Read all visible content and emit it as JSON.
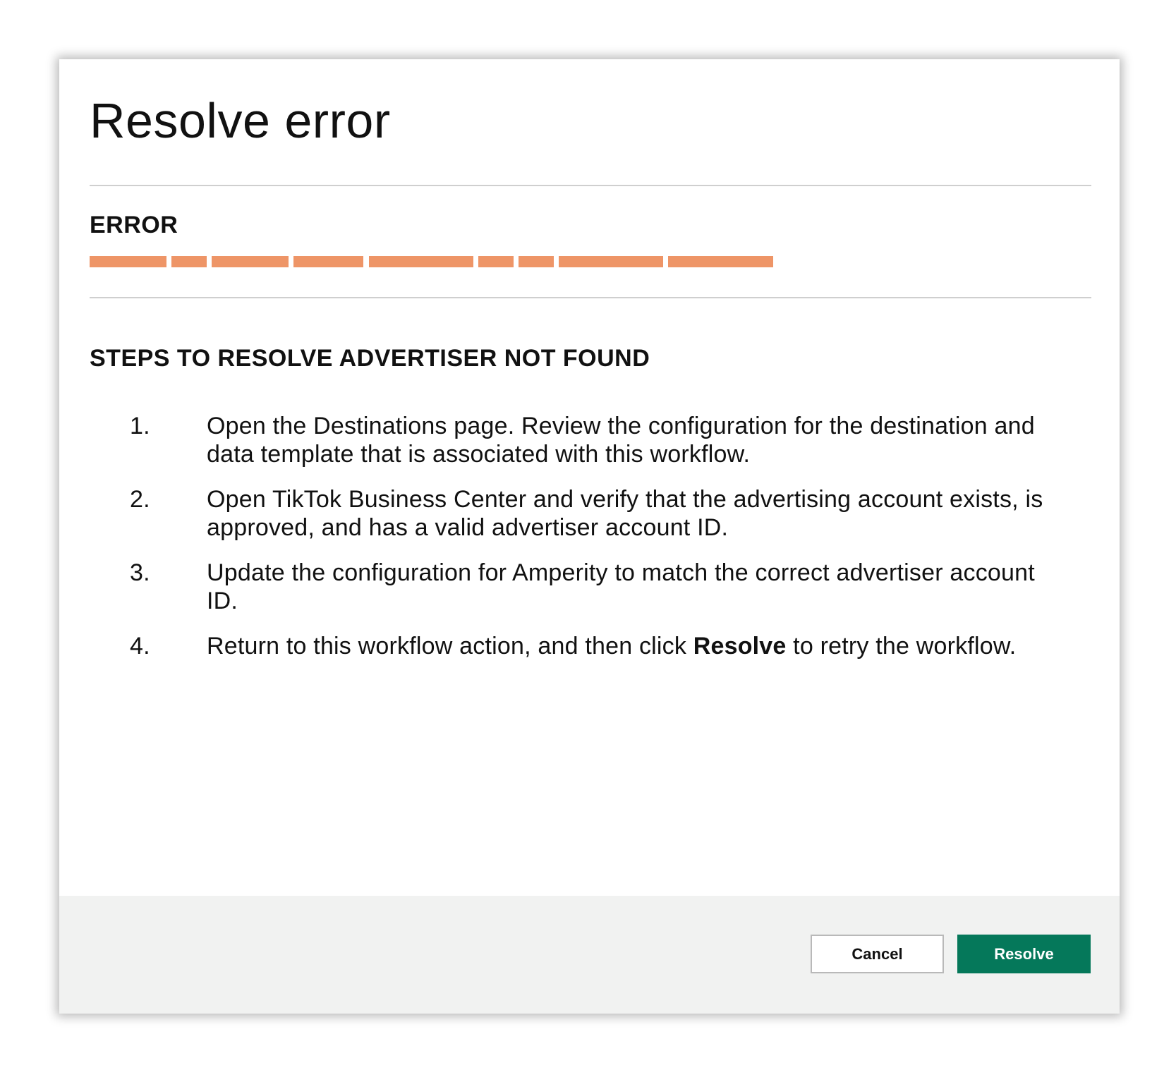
{
  "dialog": {
    "title": "Resolve error",
    "error_label": "ERROR",
    "steps_heading": "STEPS TO RESOLVE ADVERTISER NOT FOUND",
    "steps": [
      {
        "num": "1.",
        "text": "Open the Destinations page. Review the configuration for the destination and data template that is associated with this workflow."
      },
      {
        "num": "2.",
        "text": "Open TikTok Business Center and verify that the advertising account exists, is approved, and has a valid advertiser account ID."
      },
      {
        "num": "3.",
        "text": "Update the configuration for Amperity to match the correct advertiser account ID."
      },
      {
        "num": "4.",
        "text_before": "Return to this workflow action, and then click ",
        "text_bold": "Resolve",
        "text_after": " to retry the workflow."
      }
    ]
  },
  "footer": {
    "cancel_label": "Cancel",
    "resolve_label": "Resolve"
  },
  "colors": {
    "redaction": "#ee9567",
    "primary_button": "#05785a",
    "footer_background": "#f1f2f1"
  }
}
